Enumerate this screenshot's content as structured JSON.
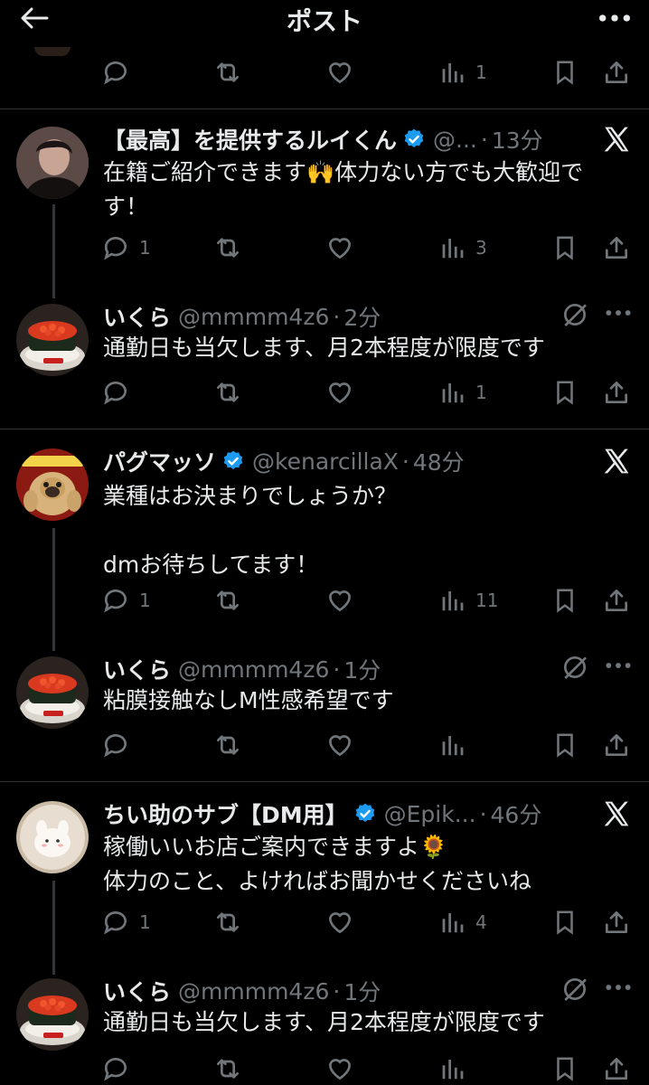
{
  "topbar": {
    "title": "ポスト"
  },
  "top_actions": {
    "views": "1"
  },
  "posts": [
    {
      "name": "【最高】を提供するルイくん",
      "handle": "@...",
      "time": "13分",
      "text": "在籍ご紹介できます🙌体力ない方でも大歓迎です！",
      "text_line1": "在籍ご紹介できます🙌体力ない方でも大歓迎で",
      "text_line2": "す！",
      "replies": "1",
      "views": "3",
      "reply": {
        "name": "いくら",
        "handle": "@mmmm4z6",
        "time": "2分",
        "text": "通勤日も当欠します、月2本程度が限度です",
        "views": "1"
      }
    },
    {
      "name": "パグマッソ",
      "handle": "@kenarcillaX",
      "time": "48分",
      "text_line1": "業種はお決まりでしょうか？",
      "text_line2": "dmお待ちしてます！",
      "replies": "1",
      "views": "11",
      "reply": {
        "name": "いくら",
        "handle": "@mmmm4z6",
        "time": "1分",
        "text": "粘膜接触なしM性感希望です",
        "views": ""
      }
    },
    {
      "name": "ちい助のサブ【DM用】",
      "handle": "@Epik...",
      "time": "46分",
      "text_line1": "稼働いいお店ご案内できますよ🌻",
      "text_line2": "体力のこと、よければお聞かせくださいね",
      "replies": "1",
      "views": "4",
      "reply": {
        "name": "いくら",
        "handle": "@mmmm4z6",
        "time": "1分",
        "text": "通勤日も当欠します、月2本程度が限度です",
        "views": ""
      }
    }
  ],
  "separator": "·",
  "colors": {
    "accent": "#1d9bf0",
    "muted": "#71767b",
    "bg": "#000000",
    "text": "#e7e9ea"
  }
}
